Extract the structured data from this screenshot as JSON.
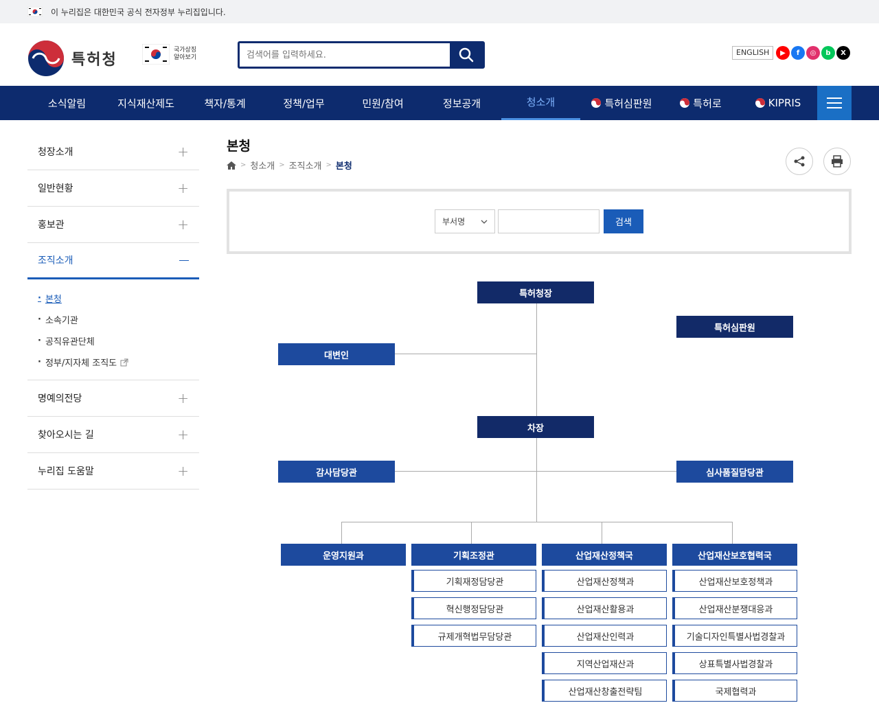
{
  "gov_banner": {
    "text": "이 누리집은 대한민국 공식 전자정부 누리집입니다."
  },
  "header": {
    "logo_text": "특허청",
    "symbol_text": "국가상징 알아보기",
    "search_placeholder": "검색어를 입력하세요.",
    "english_label": "ENGLISH",
    "sns": [
      {
        "name": "youtube-icon",
        "glyph": "▶",
        "color": "#ff0000"
      },
      {
        "name": "facebook-icon",
        "glyph": "f",
        "color": "#1877f2"
      },
      {
        "name": "instagram-icon",
        "glyph": "◎",
        "color": "#e1306c"
      },
      {
        "name": "blog-icon",
        "glyph": "b",
        "color": "#03c75a"
      },
      {
        "name": "x-icon",
        "glyph": "X",
        "color": "#000000"
      }
    ]
  },
  "gnb": {
    "items": [
      {
        "label": "소식알림"
      },
      {
        "label": "지식재산제도"
      },
      {
        "label": "책자/통계"
      },
      {
        "label": "정책/업무"
      },
      {
        "label": "민원/참여"
      },
      {
        "label": "정보공개"
      },
      {
        "label": "청소개"
      },
      {
        "label": "특허심판원"
      },
      {
        "label": "특허로"
      },
      {
        "label": "KIPRIS"
      }
    ]
  },
  "lnb": {
    "items": [
      {
        "label": "청장소개"
      },
      {
        "label": "일반현황"
      },
      {
        "label": "홍보관"
      },
      {
        "label": "조직소개"
      },
      {
        "label": "명예의전당"
      },
      {
        "label": "찾아오시는 길"
      },
      {
        "label": "누리집 도움말"
      }
    ],
    "sub": [
      {
        "label": "본청"
      },
      {
        "label": "소속기관"
      },
      {
        "label": "공직유관단체"
      },
      {
        "label": "정부/지자체 조직도"
      }
    ]
  },
  "content": {
    "title": "본청",
    "breadcrumb": [
      "청소개",
      "조직소개",
      "본청"
    ],
    "search": {
      "select_label": "부서명",
      "button_label": "검색"
    }
  },
  "org": {
    "commissioner": "특허청장",
    "tribunal": "특허심판원",
    "spokesperson": "대변인",
    "deputy": "차장",
    "audit": "감사담당관",
    "quality": "심사품질담당관",
    "divisions": [
      {
        "name": "운영지원과",
        "units": []
      },
      {
        "name": "기획조정관",
        "units": [
          "기획재정담당관",
          "혁신행정담당관",
          "규제개혁법무담당관"
        ]
      },
      {
        "name": "산업재산정책국",
        "units": [
          "산업재산정책과",
          "산업재산활용과",
          "산업재산인력과",
          "지역산업재산과",
          "산업재산창출전략팀"
        ]
      },
      {
        "name": "산업재산보호협력국",
        "units": [
          "산업재산보호정책과",
          "산업재산분쟁대응과",
          "기술디자인특별사법경찰과",
          "상표특별사법경찰과",
          "국제협력과"
        ]
      }
    ]
  }
}
